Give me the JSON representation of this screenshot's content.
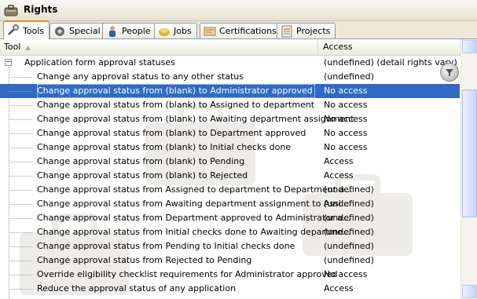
{
  "window": {
    "title": "Rights"
  },
  "tabs": [
    {
      "label": "Tools",
      "icon": "tools-icon",
      "active": true
    },
    {
      "label": "Special",
      "icon": "gear-icon"
    },
    {
      "label": "People",
      "icon": "person-icon"
    },
    {
      "label": "Jobs",
      "icon": "jobs-icon"
    },
    {
      "label": "Certifications",
      "icon": "certificate-icon"
    },
    {
      "label": "Projects",
      "icon": "projects-icon"
    }
  ],
  "table": {
    "columns": [
      "Tool",
      "Access"
    ],
    "group": {
      "label": "Application form approval statuses",
      "access": "(undefined) (detail rights vary)"
    },
    "rows": [
      {
        "tool": "Change any approval status to any other status",
        "access": "(undefined)"
      },
      {
        "tool": "Change approval status from (blank) to Administrator approved",
        "access": "No access"
      },
      {
        "tool": "Change approval status from (blank) to Assigned to department",
        "access": "No access"
      },
      {
        "tool": "Change approval status from (blank) to Awaiting department assignment",
        "access": "No access"
      },
      {
        "tool": "Change approval status from (blank) to Department approved",
        "access": "No access"
      },
      {
        "tool": "Change approval status from (blank) to Initial checks done",
        "access": "No access"
      },
      {
        "tool": "Change approval status from (blank) to Pending",
        "access": "Access"
      },
      {
        "tool": "Change approval status from (blank) to Rejected",
        "access": "Access"
      },
      {
        "tool": "Change approval status from Assigned to department to Department a...",
        "access": "(undefined)"
      },
      {
        "tool": "Change approval status from Awaiting department assignment to Assi...",
        "access": "(undefined)"
      },
      {
        "tool": "Change approval status from Department approved to Administrator a...",
        "access": "(undefined)"
      },
      {
        "tool": "Change approval status from Initial checks done to Awaiting departme...",
        "access": "(undefined)"
      },
      {
        "tool": "Change approval status from Pending to Initial checks done",
        "access": "(undefined)"
      },
      {
        "tool": "Change approval status from Rejected to Pending",
        "access": "(undefined)"
      },
      {
        "tool": "Override eligibility checklist requirements for Administrator approved",
        "access": "No access"
      },
      {
        "tool": "Reduce the approval status of any application",
        "access": "Access"
      }
    ],
    "selected_row": 1
  },
  "colors": {
    "selection": "#316ac5",
    "active_tab_accent": "#e68b2c"
  }
}
